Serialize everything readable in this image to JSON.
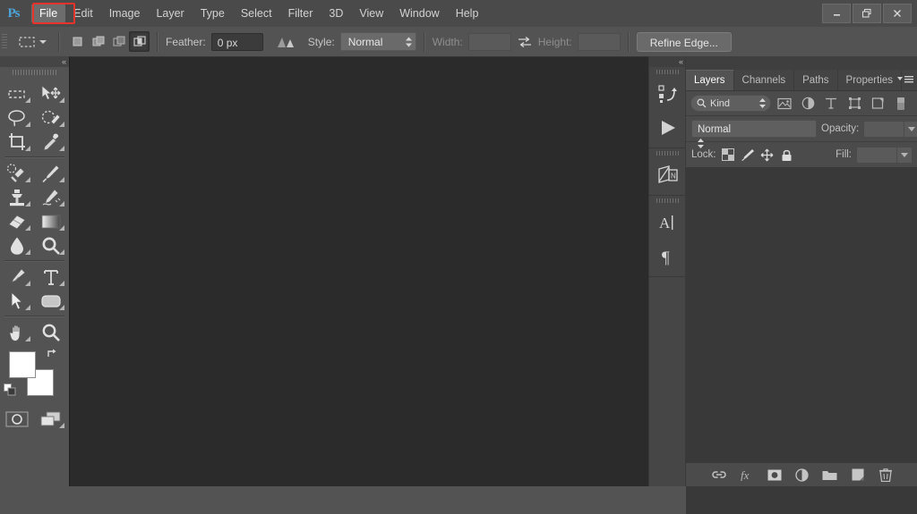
{
  "app": {
    "name": "Adobe Photoshop",
    "logo_text": "Ps"
  },
  "menubar": {
    "items": [
      {
        "label": "File",
        "active": true,
        "highlighted": true
      },
      {
        "label": "Edit",
        "active": false,
        "highlighted": false
      },
      {
        "label": "Image",
        "active": false,
        "highlighted": false
      },
      {
        "label": "Layer",
        "active": false,
        "highlighted": false
      },
      {
        "label": "Type",
        "active": false,
        "highlighted": false
      },
      {
        "label": "Select",
        "active": false,
        "highlighted": false
      },
      {
        "label": "Filter",
        "active": false,
        "highlighted": false
      },
      {
        "label": "3D",
        "active": false,
        "highlighted": false
      },
      {
        "label": "View",
        "active": false,
        "highlighted": false
      },
      {
        "label": "Window",
        "active": false,
        "highlighted": false
      },
      {
        "label": "Help",
        "active": false,
        "highlighted": false
      }
    ],
    "highlight_color": "#e8332a",
    "window_controls": [
      {
        "name": "minimize-button",
        "glyph": "minimize"
      },
      {
        "name": "restore-button",
        "glyph": "restore"
      },
      {
        "name": "close-button",
        "glyph": "close"
      }
    ]
  },
  "options_bar": {
    "tool_preset_icon": "rectangular-marquee-icon",
    "selection_modes": [
      {
        "name": "new-selection",
        "active": false
      },
      {
        "name": "add-to-selection",
        "active": false
      },
      {
        "name": "subtract-from-selection",
        "active": false
      },
      {
        "name": "intersect-with-selection",
        "active": true
      }
    ],
    "feather_label": "Feather:",
    "feather_value": "0 px",
    "antialias_icon": "anti-alias-icon",
    "style_label": "Style:",
    "style_value": "Normal",
    "width_label": "Width:",
    "width_value": "",
    "swap_icon": "swap-width-height-icon",
    "height_label": "Height:",
    "height_value": "",
    "refine_edge_label": "Refine Edge..."
  },
  "toolbar": {
    "collapse_icon": "collapse-chevron-icon",
    "tools": [
      [
        {
          "name": "rectangular-marquee-tool",
          "icon": "marquee-icon",
          "has_flyout": true
        },
        {
          "name": "move-tool",
          "icon": "move-icon",
          "has_flyout": true
        }
      ],
      [
        {
          "name": "lasso-tool",
          "icon": "lasso-icon",
          "has_flyout": true
        },
        {
          "name": "quick-selection-tool",
          "icon": "quick-selection-icon",
          "has_flyout": true
        }
      ],
      [
        {
          "name": "crop-tool",
          "icon": "crop-icon",
          "has_flyout": true
        },
        {
          "name": "eyedropper-tool",
          "icon": "eyedropper-icon",
          "has_flyout": true
        }
      ],
      [
        {
          "name": "spot-healing-brush-tool",
          "icon": "healing-brush-icon",
          "has_flyout": true
        },
        {
          "name": "brush-tool",
          "icon": "brush-icon",
          "has_flyout": true
        }
      ],
      [
        {
          "name": "clone-stamp-tool",
          "icon": "clone-stamp-icon",
          "has_flyout": true
        },
        {
          "name": "history-brush-tool",
          "icon": "history-brush-icon",
          "has_flyout": true
        }
      ],
      [
        {
          "name": "eraser-tool",
          "icon": "eraser-icon",
          "has_flyout": true
        },
        {
          "name": "gradient-tool",
          "icon": "gradient-icon",
          "has_flyout": true
        }
      ],
      [
        {
          "name": "blur-tool",
          "icon": "blur-drop-icon",
          "has_flyout": true
        },
        {
          "name": "dodge-tool",
          "icon": "dodge-icon",
          "has_flyout": true
        }
      ],
      [
        {
          "name": "pen-tool",
          "icon": "pen-icon",
          "has_flyout": true
        },
        {
          "name": "type-tool",
          "icon": "type-t-icon",
          "has_flyout": true
        }
      ],
      [
        {
          "name": "path-selection-tool",
          "icon": "path-arrow-icon",
          "has_flyout": true
        },
        {
          "name": "rectangle-shape-tool",
          "icon": "rounded-rect-icon",
          "has_flyout": true
        }
      ],
      [
        {
          "name": "hand-tool",
          "icon": "hand-icon",
          "has_flyout": true
        },
        {
          "name": "zoom-tool",
          "icon": "zoom-magnifier-icon",
          "has_flyout": false
        }
      ]
    ],
    "foreground_color": "#ffffff",
    "background_color": "#ffffff",
    "swap_colors_icon": "swap-colors-icon",
    "default_colors_icon": "default-colors-icon",
    "quick_mask_icon": "quick-mask-icon",
    "screen_mode_icon": "screen-mode-icon"
  },
  "canvas": {
    "background_color": "#2b2b2b",
    "document_open": false
  },
  "mini_dock": {
    "collapse_icon": "collapse-chevron-icon",
    "buttons": [
      {
        "name": "history-panel-button",
        "icon": "history-icon"
      },
      {
        "name": "actions-panel-button",
        "icon": "play-icon"
      },
      {
        "name": "adjustments-panel-button",
        "icon": "adjustments-icon"
      },
      {
        "name": "character-panel-button",
        "icon": "character-a-icon"
      },
      {
        "name": "paragraph-panel-button",
        "icon": "paragraph-pilcrow-icon"
      }
    ]
  },
  "layers_panel": {
    "tabs": [
      {
        "label": "Layers",
        "active": true
      },
      {
        "label": "Channels",
        "active": false
      },
      {
        "label": "Paths",
        "active": false
      },
      {
        "label": "Properties",
        "active": false
      }
    ],
    "panel_menu_icon": "panel-menu-icon",
    "filter": {
      "search_icon": "search-icon",
      "kind_label": "Kind",
      "icons": [
        {
          "name": "filter-pixel-layers-icon"
        },
        {
          "name": "filter-adjustment-layers-icon"
        },
        {
          "name": "filter-type-layers-icon"
        },
        {
          "name": "filter-shape-layers-icon"
        },
        {
          "name": "filter-smart-object-icon"
        },
        {
          "name": "filter-toggle-switch"
        }
      ]
    },
    "blend_mode": "Normal",
    "opacity_label": "Opacity:",
    "opacity_value": "",
    "lock_label": "Lock:",
    "lock_icons": [
      {
        "name": "lock-transparent-pixels-icon"
      },
      {
        "name": "lock-image-pixels-icon"
      },
      {
        "name": "lock-position-icon"
      },
      {
        "name": "lock-all-icon"
      }
    ],
    "fill_label": "Fill:",
    "fill_value": "",
    "layers": [],
    "footer_buttons": [
      {
        "name": "link-layers-button",
        "icon": "link-icon"
      },
      {
        "name": "layer-style-button",
        "icon": "fx-icon"
      },
      {
        "name": "add-layer-mask-button",
        "icon": "mask-icon"
      },
      {
        "name": "new-adjustment-layer-button",
        "icon": "adjustment-circle-icon"
      },
      {
        "name": "new-group-button",
        "icon": "folder-icon"
      },
      {
        "name": "new-layer-button",
        "icon": "new-layer-icon"
      },
      {
        "name": "delete-layer-button",
        "icon": "trash-icon"
      }
    ]
  }
}
